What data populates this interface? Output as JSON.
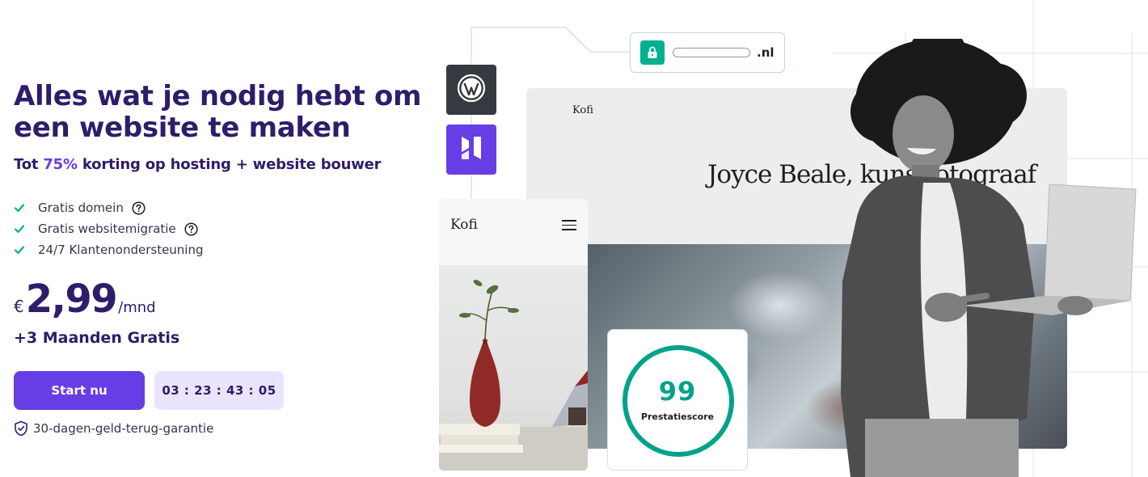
{
  "hero": {
    "title": "Alles wat je nodig hebt om een website te maken",
    "subtitle_prefix": "Tot ",
    "subtitle_accent": "75%",
    "subtitle_suffix": " korting op hosting + website bouwer"
  },
  "features": [
    {
      "label": "Gratis domein",
      "has_help": true
    },
    {
      "label": "Gratis websitemigratie",
      "has_help": true
    },
    {
      "label": "24/7 Klantenondersteuning",
      "has_help": false
    }
  ],
  "pricing": {
    "currency": "€",
    "amount": "2,99",
    "period": "/mnd",
    "bonus": "+3 Maanden Gratis"
  },
  "cta": {
    "button_label": "Start nu",
    "countdown": "03 : 23 : 43 : 05"
  },
  "guarantee": {
    "label": "30-dagen-geld-terug-garantie"
  },
  "visual": {
    "domain_tld": ".nl",
    "desktop_logo": "Kofi",
    "desktop_heading": "Joyce Beale, kunstfotograaf",
    "mobile_logo": "Kofi",
    "score_value": "99",
    "score_label": "Prestatiescore"
  },
  "colors": {
    "primary": "#673de6",
    "heading": "#2f1c6a",
    "check": "#00b090",
    "score": "#00a389",
    "countdown_bg": "#ebe4ff"
  },
  "icons": {
    "feature_check": "check-icon",
    "feature_help": "help-circle-icon",
    "guarantee": "shield-check-icon",
    "wordpress": "wordpress-icon",
    "builder": "hostinger-logo-icon",
    "lock": "lock-icon",
    "mobile_menu": "hamburger-menu-icon"
  }
}
